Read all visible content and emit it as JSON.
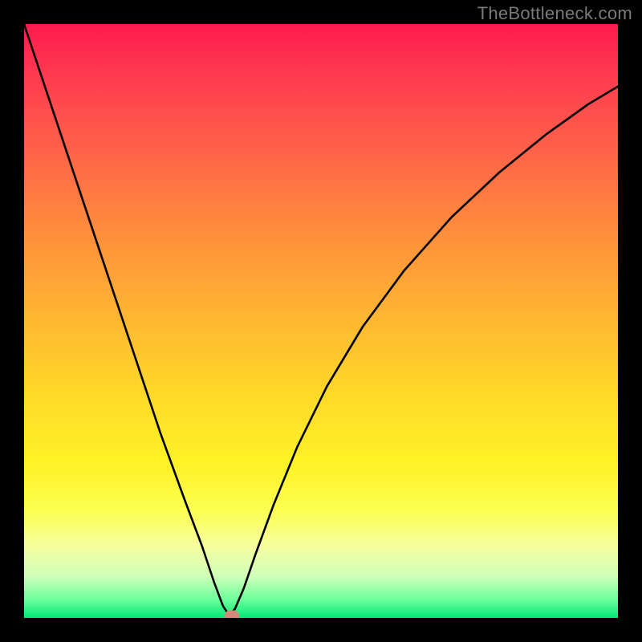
{
  "watermark": "TheBottleneck.com",
  "chart_data": {
    "type": "line",
    "title": "",
    "xlabel": "",
    "ylabel": "",
    "x_range": [
      0,
      1
    ],
    "y_range": [
      0,
      1
    ],
    "minimum_point": {
      "x": 0.345,
      "y": 0.995
    },
    "series": [
      {
        "name": "bottleneck-curve",
        "points": [
          {
            "x": 0.0,
            "y": 0.0
          },
          {
            "x": 0.03,
            "y": 0.09
          },
          {
            "x": 0.07,
            "y": 0.21
          },
          {
            "x": 0.11,
            "y": 0.33
          },
          {
            "x": 0.15,
            "y": 0.45
          },
          {
            "x": 0.19,
            "y": 0.57
          },
          {
            "x": 0.23,
            "y": 0.69
          },
          {
            "x": 0.27,
            "y": 0.8
          },
          {
            "x": 0.3,
            "y": 0.88
          },
          {
            "x": 0.32,
            "y": 0.94
          },
          {
            "x": 0.335,
            "y": 0.98
          },
          {
            "x": 0.345,
            "y": 0.995
          },
          {
            "x": 0.355,
            "y": 0.985
          },
          {
            "x": 0.37,
            "y": 0.95
          },
          {
            "x": 0.39,
            "y": 0.892
          },
          {
            "x": 0.42,
            "y": 0.81
          },
          {
            "x": 0.46,
            "y": 0.712
          },
          {
            "x": 0.51,
            "y": 0.61
          },
          {
            "x": 0.57,
            "y": 0.51
          },
          {
            "x": 0.64,
            "y": 0.415
          },
          {
            "x": 0.72,
            "y": 0.325
          },
          {
            "x": 0.8,
            "y": 0.25
          },
          {
            "x": 0.88,
            "y": 0.185
          },
          {
            "x": 0.95,
            "y": 0.135
          },
          {
            "x": 1.0,
            "y": 0.105
          }
        ]
      }
    ],
    "marker": {
      "x": 0.35,
      "y": 0.996,
      "color": "#d28a7a"
    }
  }
}
